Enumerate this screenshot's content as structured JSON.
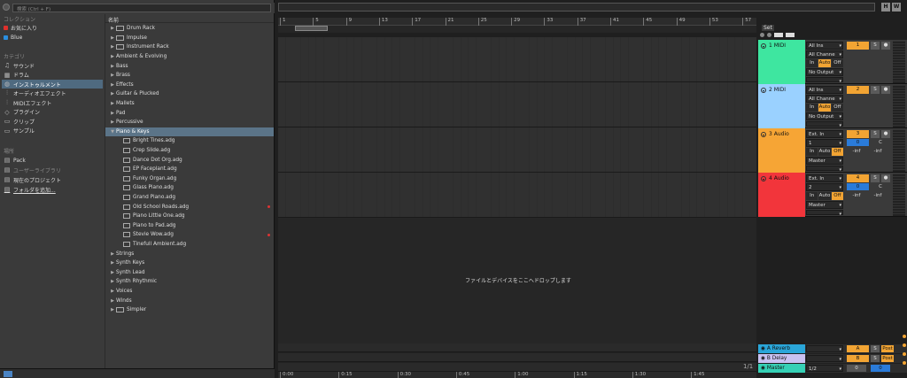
{
  "search": {
    "placeholder": "検索 (Ctrl + F)"
  },
  "places": {
    "collections_title": "コレクション",
    "collections": [
      {
        "label": "お気に入り",
        "color": "#e0302c"
      },
      {
        "label": "Blue",
        "color": "#2a8fe0"
      }
    ],
    "categories_title": "カテゴリ",
    "categories": [
      {
        "label": "サウンド",
        "icon": "note-icon"
      },
      {
        "label": "ドラム",
        "icon": "drum-icon"
      },
      {
        "label": "インストゥルメント",
        "icon": "instrument-icon"
      },
      {
        "label": "オーディオエフェクト",
        "icon": "audio-effect-icon"
      },
      {
        "label": "MIDIエフェクト",
        "icon": "midi-effect-icon"
      },
      {
        "label": "プラグイン",
        "icon": "plugin-icon"
      },
      {
        "label": "クリップ",
        "icon": "clip-icon"
      },
      {
        "label": "サンプル",
        "icon": "sample-icon"
      }
    ],
    "locations_title": "場所",
    "locations": [
      {
        "label": "Pack",
        "icon": "pack-icon"
      },
      {
        "label": "ユーザーライブラリ",
        "icon": "user-library-icon"
      },
      {
        "label": "現在のプロジェクト",
        "icon": "project-icon"
      },
      {
        "label": "フォルダを追加...",
        "icon": "add-folder-icon"
      }
    ]
  },
  "filelist": {
    "header": "名前",
    "rows": [
      {
        "label": "Drum Rack",
        "kind": "device"
      },
      {
        "label": "Impulse",
        "kind": "device"
      },
      {
        "label": "Instrument Rack",
        "kind": "device"
      },
      {
        "label": "Ambient & Evolving",
        "kind": "folder"
      },
      {
        "label": "Bass",
        "kind": "folder"
      },
      {
        "label": "Brass",
        "kind": "folder"
      },
      {
        "label": "Effects",
        "kind": "folder"
      },
      {
        "label": "Guitar & Plucked",
        "kind": "folder"
      },
      {
        "label": "Mallets",
        "kind": "folder"
      },
      {
        "label": "Pad",
        "kind": "folder"
      },
      {
        "label": "Percussive",
        "kind": "folder"
      },
      {
        "label": "Piano & Keys",
        "kind": "open"
      },
      {
        "label": "Bright Tines.adg",
        "kind": "file"
      },
      {
        "label": "Crep Slide.adg",
        "kind": "file"
      },
      {
        "label": "Dance Dot Org.adg",
        "kind": "file"
      },
      {
        "label": "EP Faceplant.adg",
        "kind": "file"
      },
      {
        "label": "Funky Organ.adg",
        "kind": "file"
      },
      {
        "label": "Glass Piano.adg",
        "kind": "file"
      },
      {
        "label": "Grand Piano.adg",
        "kind": "file"
      },
      {
        "label": "Old School Roads.adg",
        "kind": "file",
        "tag": true
      },
      {
        "label": "Piano Little One.adg",
        "kind": "file"
      },
      {
        "label": "Piano to Pad.adg",
        "kind": "file"
      },
      {
        "label": "Stevie Wow.adg",
        "kind": "file",
        "tag": true
      },
      {
        "label": "Tinefull Ambient.adg",
        "kind": "file"
      },
      {
        "label": "Strings",
        "kind": "folder"
      },
      {
        "label": "Synth Keys",
        "kind": "folder"
      },
      {
        "label": "Synth Lead",
        "kind": "folder"
      },
      {
        "label": "Synth Rhythmic",
        "kind": "folder"
      },
      {
        "label": "Voices",
        "kind": "folder"
      },
      {
        "label": "Winds",
        "kind": "folder"
      },
      {
        "label": "Simpler",
        "kind": "device"
      }
    ]
  },
  "topbar": {
    "h": "H",
    "w": "W"
  },
  "ruler": {
    "bars": [
      "1",
      "5",
      "9",
      "13",
      "17",
      "21",
      "25",
      "29",
      "33",
      "37",
      "41",
      "45",
      "49",
      "53",
      "57"
    ]
  },
  "timeruler": {
    "marks": [
      "0:00",
      "0:15",
      "0:30",
      "0:45",
      "1:00",
      "1:15",
      "1:30",
      "1:45"
    ]
  },
  "set": {
    "label": "Set"
  },
  "drop_text": "ファイルとデバイスをここへドロップします",
  "page_indicator": "1/1",
  "tracks": [
    {
      "name": "1 MIDI",
      "color": "#3ee6a0",
      "in": "All Ins",
      "ch": "All Channe",
      "out": "No Output",
      "num": "1",
      "mon": [
        "In",
        "Auto",
        "Off"
      ],
      "mon_on": 1
    },
    {
      "name": "2 MIDI",
      "color": "#9ad1ff",
      "in": "All Ins",
      "ch": "All Channe",
      "out": "No Output",
      "num": "2",
      "mon": [
        "In",
        "Auto",
        "Off"
      ],
      "mon_on": 1
    },
    {
      "name": "3 Audio",
      "color": "#f6a535",
      "in": "Ext. In",
      "ch": "1",
      "out": "Master",
      "num": "3",
      "mon": [
        "In",
        "Auto",
        "Off"
      ],
      "mon_on": 2,
      "vol": "0",
      "pan": "C",
      "sendA": "-inf",
      "sendB": "-inf"
    },
    {
      "name": "4 Audio",
      "color": "#f2353b",
      "in": "Ext. In",
      "ch": "2",
      "out": "Master",
      "num": "4",
      "mon": [
        "In",
        "Auto",
        "Off"
      ],
      "mon_on": 2,
      "vol": "0",
      "pan": "C",
      "sendA": "-inf",
      "sendB": "-inf"
    }
  ],
  "returns": [
    {
      "name": "A Reverb",
      "color": "#2aa6d9",
      "letter": "A",
      "post": "Post"
    },
    {
      "name": "B Delay",
      "color": "#c9c2f2",
      "letter": "B",
      "post": "Post"
    },
    {
      "name": "Master",
      "color": "#36d1b6",
      "ratio": "1/2",
      "vol": "0",
      "pan": "0"
    }
  ],
  "solo_label": "S"
}
